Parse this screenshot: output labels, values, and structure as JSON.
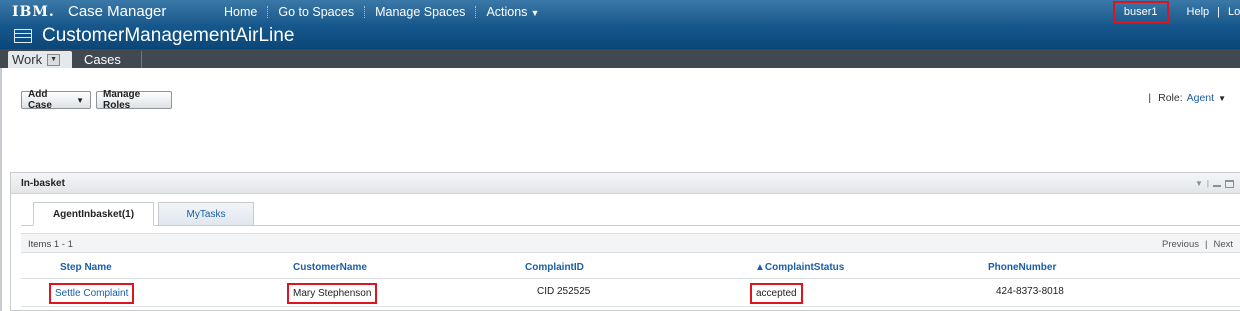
{
  "topbar": {
    "logo": "IBM.",
    "product": "Case Manager",
    "nav": [
      {
        "label": "Home"
      },
      {
        "label": "Go to Spaces"
      },
      {
        "label": "Manage Spaces"
      },
      {
        "label": "Actions"
      }
    ],
    "user": "buser1",
    "help": "Help",
    "separator": "|",
    "logout": "Log"
  },
  "solution": {
    "title": "CustomerManagementAirLine"
  },
  "tabs": [
    {
      "label": "Work"
    },
    {
      "label": "Cases"
    }
  ],
  "toolbar": {
    "add_case": "Add Case",
    "manage_roles": "Manage Roles",
    "role_pipe": "|",
    "role_label": "Role:",
    "role_value": "Agent"
  },
  "inbasket": {
    "title": "In-basket",
    "tabs": [
      {
        "label": "AgentInbasket(1)"
      },
      {
        "label": "MyTasks"
      }
    ],
    "items_label": "Items 1 - 1",
    "previous": "Previous",
    "pager_sep": "|",
    "next": "Next",
    "columns": [
      "Step Name",
      "CustomerName",
      "ComplaintID",
      "▲ComplaintStatus",
      "PhoneNumber"
    ],
    "rows": [
      {
        "step_name": "Settle Complaint",
        "customer_name": "Mary Stephenson",
        "complaint_id": "CID 252525",
        "complaint_status": "accepted",
        "phone_number": "424-8373-8018"
      }
    ]
  },
  "colors": {
    "banner": "#1b5a8c",
    "solution_bar": "#0b4677",
    "tab_bar": "#404850",
    "link": "#1a5ea8",
    "highlight": "#e0141e"
  }
}
